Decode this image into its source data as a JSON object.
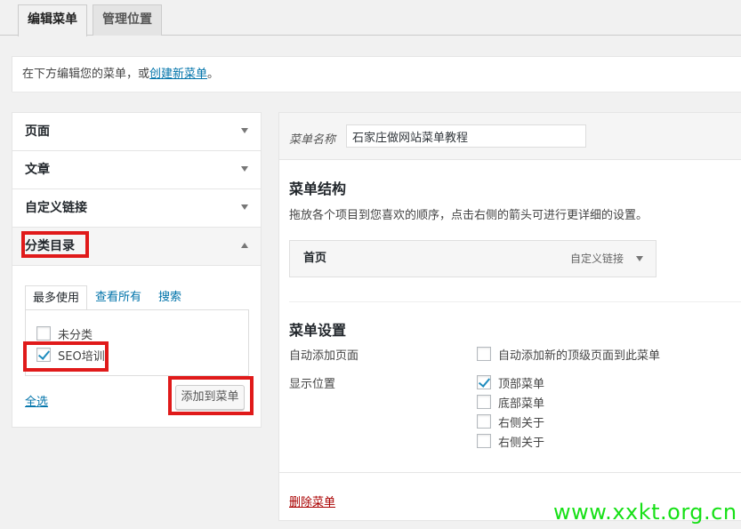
{
  "tabs": {
    "edit": "编辑菜单",
    "manage": "管理位置"
  },
  "notice": {
    "prefix": "在下方编辑您的菜单，或",
    "link": "创建新菜单",
    "suffix": "。"
  },
  "sidebar": {
    "sections": [
      {
        "label": "页面"
      },
      {
        "label": "文章"
      },
      {
        "label": "自定义链接"
      },
      {
        "label": "分类目录"
      }
    ],
    "category": {
      "tabs": [
        "最多使用",
        "查看所有",
        "搜索"
      ],
      "items": [
        {
          "label": "未分类",
          "checked": false
        },
        {
          "label": "SEO培训",
          "checked": true
        }
      ],
      "select_all": "全选",
      "add_button": "添加到菜单"
    }
  },
  "menu": {
    "name_label": "菜单名称",
    "name_value": "石家庄做网站菜单教程",
    "structure_title": "菜单结构",
    "structure_desc": "拖放各个项目到您喜欢的顺序，点击右侧的箭头可进行更详细的设置。",
    "items": [
      {
        "title": "首页",
        "type": "自定义链接"
      }
    ],
    "settings_title": "菜单设置",
    "auto_add_label": "自动添加页面",
    "auto_add_option": "自动添加新的顶级页面到此菜单",
    "location_label": "显示位置",
    "locations": [
      {
        "label": "顶部菜单",
        "checked": true
      },
      {
        "label": "底部菜单",
        "checked": false
      },
      {
        "label": "右侧关于",
        "checked": false
      },
      {
        "label": "右侧关于",
        "checked": false
      }
    ],
    "delete_link": "删除菜单"
  },
  "watermark": "www.xxkt.org.cn",
  "colors": {
    "highlight": "#e01a1a",
    "link": "#0073aa",
    "delete": "#aa0000",
    "watermark": "#16e016"
  }
}
